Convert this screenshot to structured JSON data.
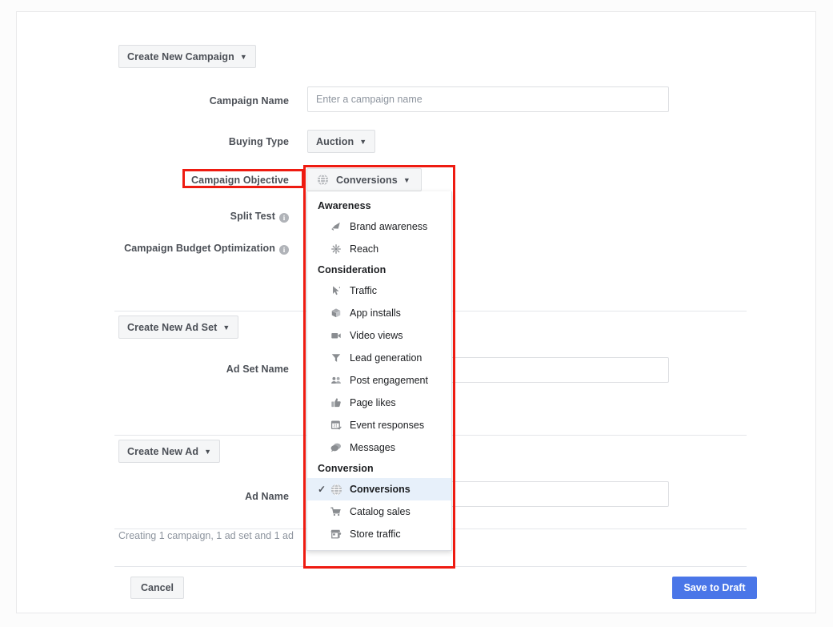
{
  "page": {
    "background_color": "#fcfcfc",
    "card_background": "#ffffff"
  },
  "campaign_section": {
    "create_button": "Create New Campaign",
    "fields": {
      "campaign_name_label": "Campaign Name",
      "campaign_name_value": "",
      "campaign_name_placeholder": "Enter a campaign name",
      "buying_type_label": "Buying Type",
      "buying_type_value": "Auction",
      "campaign_objective_label": "Campaign Objective",
      "campaign_objective_value": "Conversions",
      "split_test_label": "Split Test",
      "campaign_budget_optimization_label": "Campaign Budget Optimization"
    }
  },
  "adset_section": {
    "create_button": "Create New Ad Set",
    "adset_name_label": "Ad Set Name",
    "adset_name_value": ""
  },
  "ad_section": {
    "create_button": "Create New Ad",
    "ad_name_label": "Ad Name",
    "ad_name_value": ""
  },
  "status": {
    "text": "Creating 1 campaign, 1 ad set and 1 ad"
  },
  "footer": {
    "cancel_label": "Cancel",
    "save_label": "Save to Draft",
    "save_color": "#4a76e8"
  },
  "objective_dropdown": {
    "toggle_label": "Conversions",
    "toggle_icon": "globe-icon",
    "selected": "Conversions",
    "groups": [
      {
        "title": "Awareness",
        "items": [
          {
            "label": "Brand awareness",
            "icon": "megaphone-icon",
            "selected": false
          },
          {
            "label": "Reach",
            "icon": "reach-burst-icon",
            "selected": false
          }
        ]
      },
      {
        "title": "Consideration",
        "items": [
          {
            "label": "Traffic",
            "icon": "cursor-arrow-icon",
            "selected": false
          },
          {
            "label": "App installs",
            "icon": "box-cube-icon",
            "selected": false
          },
          {
            "label": "Video views",
            "icon": "video-camera-icon",
            "selected": false
          },
          {
            "label": "Lead generation",
            "icon": "funnel-icon",
            "selected": false
          },
          {
            "label": "Post engagement",
            "icon": "people-icon",
            "selected": false
          },
          {
            "label": "Page likes",
            "icon": "thumbs-up-icon",
            "selected": false
          },
          {
            "label": "Event responses",
            "icon": "calendar-event-icon",
            "selected": false
          },
          {
            "label": "Messages",
            "icon": "speech-bubbles-icon",
            "selected": false
          }
        ]
      },
      {
        "title": "Conversion",
        "items": [
          {
            "label": "Conversions",
            "icon": "globe-icon",
            "selected": true
          },
          {
            "label": "Catalog sales",
            "icon": "shopping-cart-icon",
            "selected": false
          },
          {
            "label": "Store traffic",
            "icon": "storefront-icon",
            "selected": false
          }
        ]
      }
    ]
  },
  "annotations": {
    "highlight_color": "#ee1b11",
    "boxes": [
      {
        "name": "campaign-objective-label-highlight"
      },
      {
        "name": "objective-dropdown-highlight"
      }
    ]
  }
}
